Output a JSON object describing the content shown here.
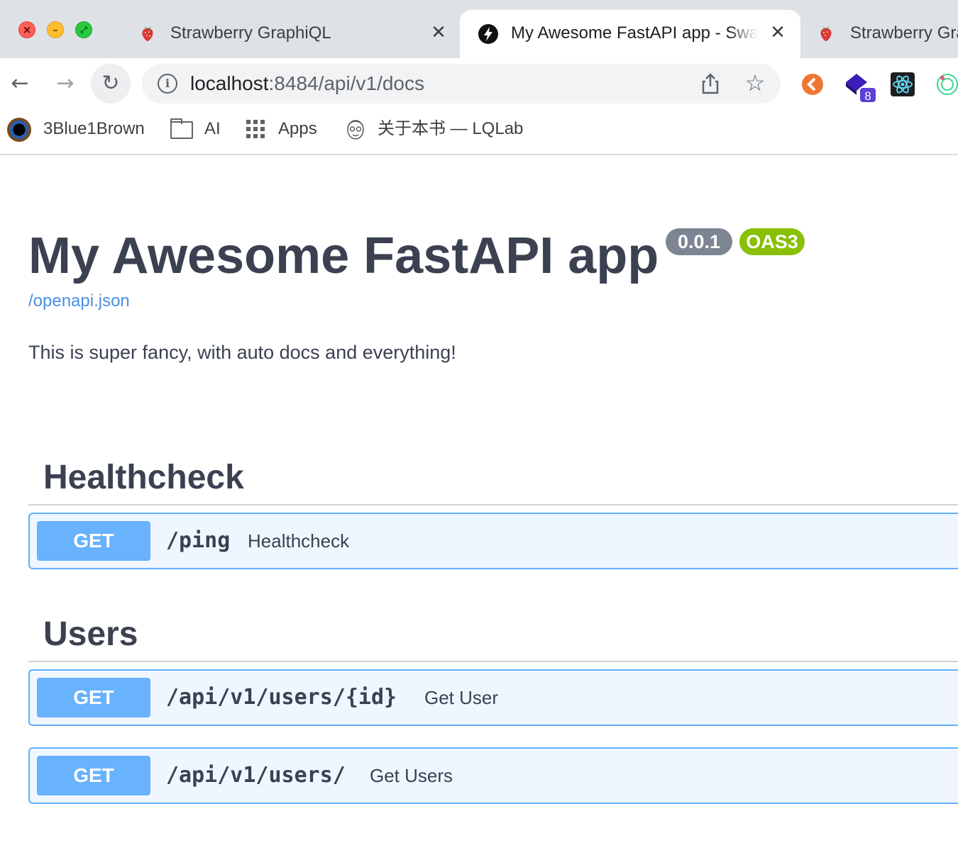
{
  "window": {
    "controls": [
      "close",
      "minimize",
      "maximize"
    ]
  },
  "tabs": [
    {
      "title": "Strawberry GraphiQL",
      "favicon": "strawberry-icon",
      "close_label": "✕",
      "active": false
    },
    {
      "title": "My Awesome FastAPI app - Swagger UI",
      "favicon": "bolt-icon",
      "close_label": "✕",
      "active": true
    },
    {
      "title": "Strawberry GraphiQL",
      "favicon": "strawberry-icon",
      "active": false
    }
  ],
  "toolbar": {
    "back_glyph": "←",
    "forward_glyph": "→",
    "reload_glyph": "↻",
    "info_glyph": "i",
    "url_host": "localhost",
    "url_rest": ":8484/api/v1/docs",
    "star_glyph": "☆",
    "extension_badge": "8"
  },
  "bookmarks": [
    {
      "label": "3Blue1Brown",
      "icon": "3blue1brown-icon"
    },
    {
      "label": "AI",
      "icon": "folder-icon"
    },
    {
      "label": "Apps",
      "icon": "apps-grid-icon"
    },
    {
      "label": "关于本书 — LQLab",
      "icon": "face-sketch-icon"
    }
  ],
  "info": {
    "title": "My Awesome FastAPI app",
    "version": "0.0.1",
    "oas_badge": "OAS3",
    "spec_link": "/openapi.json",
    "description": "This is super fancy, with auto docs and everything!"
  },
  "tags": [
    {
      "name": "Healthcheck",
      "operations": [
        {
          "method": "GET",
          "path": "/ping",
          "summary": "Healthcheck"
        }
      ]
    },
    {
      "name": "Users",
      "operations": [
        {
          "method": "GET",
          "path": "/api/v1/users/{id}",
          "summary": "Get User"
        },
        {
          "method": "GET",
          "path": "/api/v1/users/",
          "summary": "Get Users"
        }
      ]
    }
  ],
  "colors": {
    "get_method": "#61affe",
    "get_block_bg": "#eff6ff",
    "version_badge": "#7d8492",
    "oas_badge": "#89bf04",
    "link": "#4990e2",
    "text": "#3b4151"
  }
}
